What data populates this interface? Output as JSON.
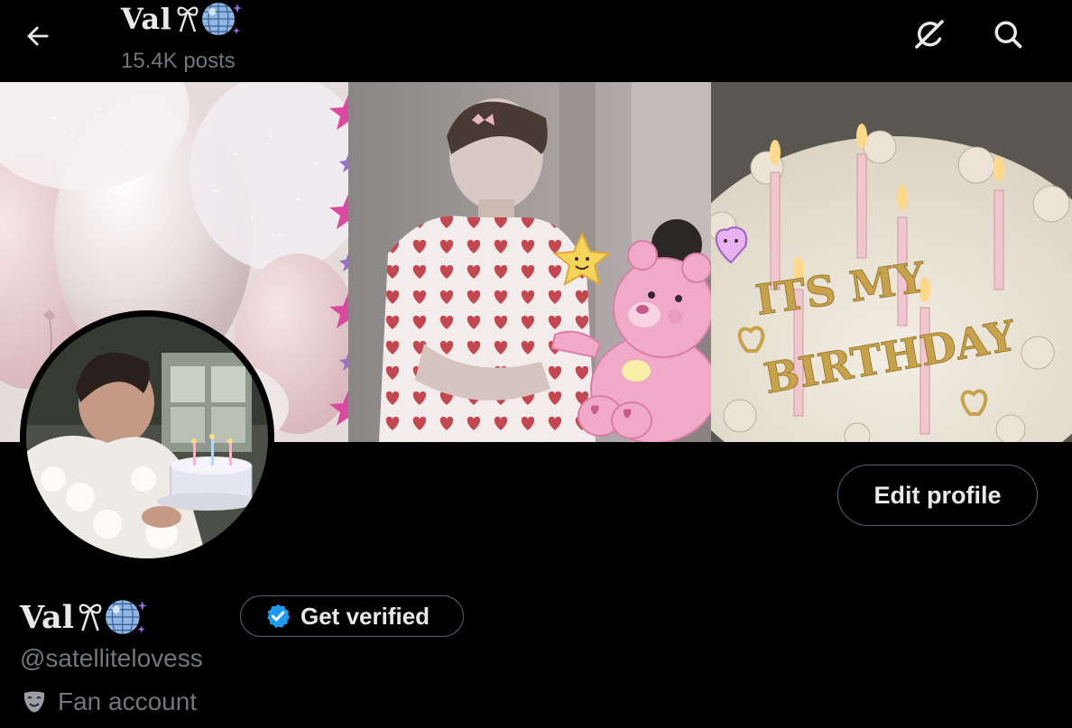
{
  "header": {
    "name": "Val",
    "name_emoji": [
      "ribbon-icon",
      "disco-ball-icon"
    ],
    "posts": "15.4K posts"
  },
  "profile": {
    "display_name": "Val",
    "display_name_emoji": [
      "ribbon-icon",
      "disco-ball-icon"
    ],
    "handle": "@satellitelovess",
    "category": "Fan account",
    "category_icon": "theater-mask-icon",
    "edit_profile_label": "Edit profile",
    "get_verified_label": "Get verified"
  },
  "banner": {
    "cake_text_line1": "ITS MY",
    "cake_text_line2": "BIRTHDAY"
  },
  "colors": {
    "background": "#000000",
    "primary_text": "#e7e9ea",
    "secondary_text": "#71767b",
    "border": "#536471",
    "verified_blue": "#1d9bf0"
  }
}
